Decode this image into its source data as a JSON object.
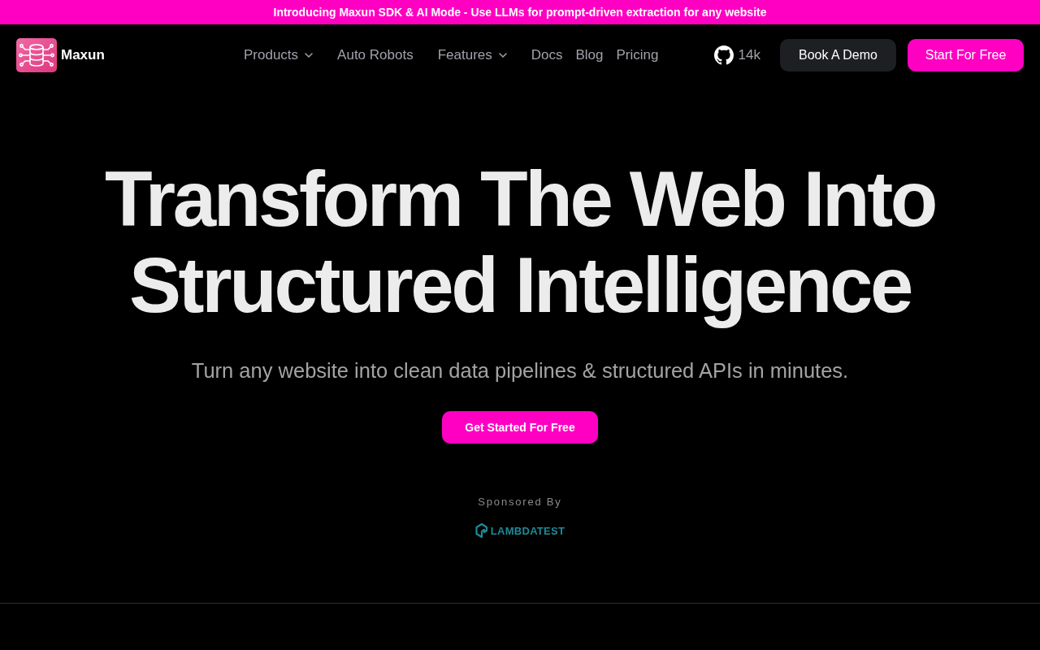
{
  "announcement": {
    "text": "Introducing Maxun SDK & AI Mode - Use LLMs for prompt-driven extraction for any website"
  },
  "header": {
    "brand": "Maxun",
    "nav": [
      {
        "label": "Products",
        "kind": "menu"
      },
      {
        "label": "Auto Robots",
        "kind": "link"
      },
      {
        "label": "Features",
        "kind": "menu"
      },
      {
        "label": "Docs",
        "kind": "link"
      },
      {
        "label": "Blog",
        "kind": "link"
      },
      {
        "label": "Pricing",
        "kind": "link"
      }
    ],
    "github_stars": "14k",
    "buttons": [
      {
        "label": "Book A Demo",
        "kind": "secondary"
      },
      {
        "label": "Start For Free",
        "kind": "primary"
      }
    ]
  },
  "hero": {
    "title_lines": [
      "Transform The Web Into",
      "Structured Intelligence"
    ],
    "subtitle": "Turn any website into clean data pipelines & structured APIs in minutes.",
    "cta": "Get Started For Free",
    "sponsor": {
      "label": "Sponsored By",
      "name": "LAMBDATEST"
    }
  }
}
